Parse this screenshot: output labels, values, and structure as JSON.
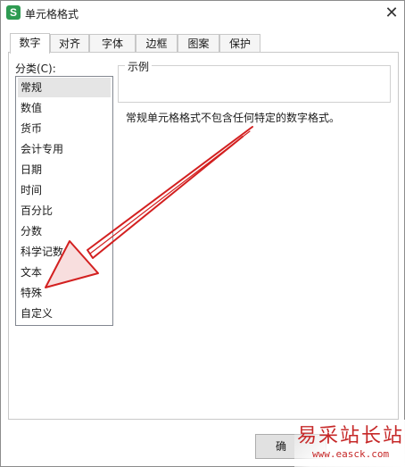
{
  "window": {
    "title": "单元格格式",
    "app_icon_letter": "S",
    "close_glyph": "✕"
  },
  "tabs": [
    {
      "label": "数字",
      "active": true
    },
    {
      "label": "对齐",
      "active": false
    },
    {
      "label": "字体",
      "active": false
    },
    {
      "label": "边框",
      "active": false
    },
    {
      "label": "图案",
      "active": false
    },
    {
      "label": "保护",
      "active": false
    }
  ],
  "category": {
    "label": "分类(C):",
    "items": [
      "常规",
      "数值",
      "货币",
      "会计专用",
      "日期",
      "时间",
      "百分比",
      "分数",
      "科学记数",
      "文本",
      "特殊",
      "自定义"
    ],
    "selected": "常规"
  },
  "sample": {
    "label": "示例",
    "value": ""
  },
  "description": "常规单元格格式不包含任何特定的数字格式。",
  "buttons": {
    "ok_visible": "确"
  },
  "annotation": {
    "color": "#d32020",
    "shape": "arrow"
  },
  "watermark": {
    "text_cn": "易采站长站",
    "url": "www.easck.com",
    "color": "#c62828"
  }
}
